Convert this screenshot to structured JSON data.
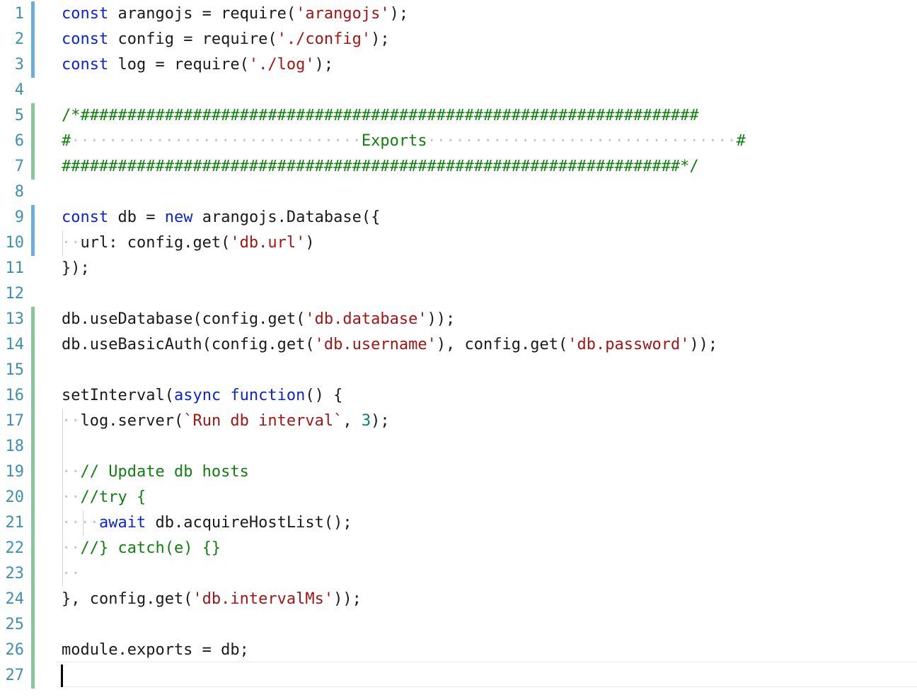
{
  "editor": {
    "lines": [
      {
        "n": "1",
        "bar": "blue",
        "tokens": [
          [
            "kw",
            "const"
          ],
          [
            "",
            "arangojs = require("
          ],
          [
            "str",
            "'arangojs'"
          ],
          [
            "",
            ");"
          ]
        ]
      },
      {
        "n": "2",
        "bar": "blue",
        "tokens": [
          [
            "kw",
            "const"
          ],
          [
            "",
            "config = require("
          ],
          [
            "str",
            "'./config'"
          ],
          [
            "",
            ");"
          ]
        ]
      },
      {
        "n": "3",
        "bar": "blue",
        "tokens": [
          [
            "kw",
            "const"
          ],
          [
            "",
            "log = require("
          ],
          [
            "str",
            "'./log'"
          ],
          [
            "",
            ");"
          ]
        ]
      },
      {
        "n": "4",
        "bar": "",
        "tokens": []
      },
      {
        "n": "5",
        "bar": "green",
        "tokens": [
          [
            "com",
            "/*##################################################################"
          ]
        ]
      },
      {
        "n": "6",
        "bar": "green",
        "tokens": [
          [
            "com",
            "#"
          ],
          [
            "dots",
            "·······························"
          ],
          [
            "com",
            "Exports"
          ],
          [
            "dots",
            "·································"
          ],
          [
            "com",
            "#"
          ]
        ]
      },
      {
        "n": "7",
        "bar": "green",
        "tokens": [
          [
            "com",
            "##################################################################*/"
          ]
        ]
      },
      {
        "n": "8",
        "bar": "",
        "tokens": []
      },
      {
        "n": "9",
        "bar": "blue",
        "tokens": [
          [
            "kw",
            "const"
          ],
          [
            "",
            "db = "
          ],
          [
            "kw",
            "new"
          ],
          [
            "",
            " arangojs.Database({"
          ]
        ]
      },
      {
        "n": "10",
        "bar": "blue",
        "tokens": [
          [
            "ws",
            "··"
          ],
          [
            "",
            "url: config.get("
          ],
          [
            "str",
            "'db.url'"
          ],
          [
            "",
            ")"
          ]
        ]
      },
      {
        "n": "11",
        "bar": "",
        "tokens": [
          [
            "",
            "});"
          ]
        ]
      },
      {
        "n": "12",
        "bar": "",
        "tokens": []
      },
      {
        "n": "13",
        "bar": "green",
        "tokens": [
          [
            "",
            "db.useDatabase(config.get("
          ],
          [
            "str",
            "'db.database'"
          ],
          [
            "",
            "));"
          ]
        ]
      },
      {
        "n": "14",
        "bar": "green",
        "tokens": [
          [
            "",
            "db.useBasicAuth(config.get("
          ],
          [
            "str",
            "'db.username'"
          ],
          [
            "",
            "), config.get("
          ],
          [
            "str",
            "'db.password'"
          ],
          [
            "",
            "));"
          ]
        ]
      },
      {
        "n": "15",
        "bar": "green",
        "tokens": []
      },
      {
        "n": "16",
        "bar": "green",
        "tokens": [
          [
            "",
            "setInterval("
          ],
          [
            "kw",
            "async"
          ],
          [
            "",
            " "
          ],
          [
            "kw",
            "function"
          ],
          [
            "",
            "() {"
          ]
        ]
      },
      {
        "n": "17",
        "bar": "green",
        "tokens": [
          [
            "ws",
            "··"
          ],
          [
            "",
            "log.server("
          ],
          [
            "str",
            "`Run db interval`"
          ],
          [
            "",
            ", "
          ],
          [
            "num",
            "3"
          ],
          [
            "",
            ");"
          ]
        ]
      },
      {
        "n": "18",
        "bar": "green",
        "tokens": []
      },
      {
        "n": "19",
        "bar": "green",
        "tokens": [
          [
            "ws",
            "··"
          ],
          [
            "com",
            "// Update db hosts"
          ]
        ]
      },
      {
        "n": "20",
        "bar": "green",
        "tokens": [
          [
            "ws",
            "··"
          ],
          [
            "com",
            "//try {"
          ]
        ]
      },
      {
        "n": "21",
        "bar": "green",
        "tokens": [
          [
            "ws",
            "····"
          ],
          [
            "kw",
            "await"
          ],
          [
            "",
            " db.acquireHostList();"
          ]
        ]
      },
      {
        "n": "22",
        "bar": "green",
        "tokens": [
          [
            "ws",
            "··"
          ],
          [
            "com",
            "//} catch(e) {}"
          ]
        ]
      },
      {
        "n": "23",
        "bar": "green",
        "tokens": [
          [
            "ws",
            "··"
          ]
        ]
      },
      {
        "n": "24",
        "bar": "green",
        "tokens": [
          [
            "",
            "}, config.get("
          ],
          [
            "str",
            "'db.intervalMs'"
          ],
          [
            "",
            "));"
          ]
        ]
      },
      {
        "n": "25",
        "bar": "green",
        "tokens": []
      },
      {
        "n": "26",
        "bar": "green",
        "tokens": [
          [
            "",
            "module.exports = db;"
          ]
        ]
      },
      {
        "n": "27",
        "bar": "green",
        "tokens": []
      }
    ]
  },
  "colors": {
    "keyword": "#0b24d6",
    "string": "#a31515",
    "comment": "#108010",
    "number": "#0b7d7d",
    "line_number": "#3f8fb0",
    "change_bar_blue": "#6aaee0",
    "change_bar_green": "#88c79a"
  }
}
